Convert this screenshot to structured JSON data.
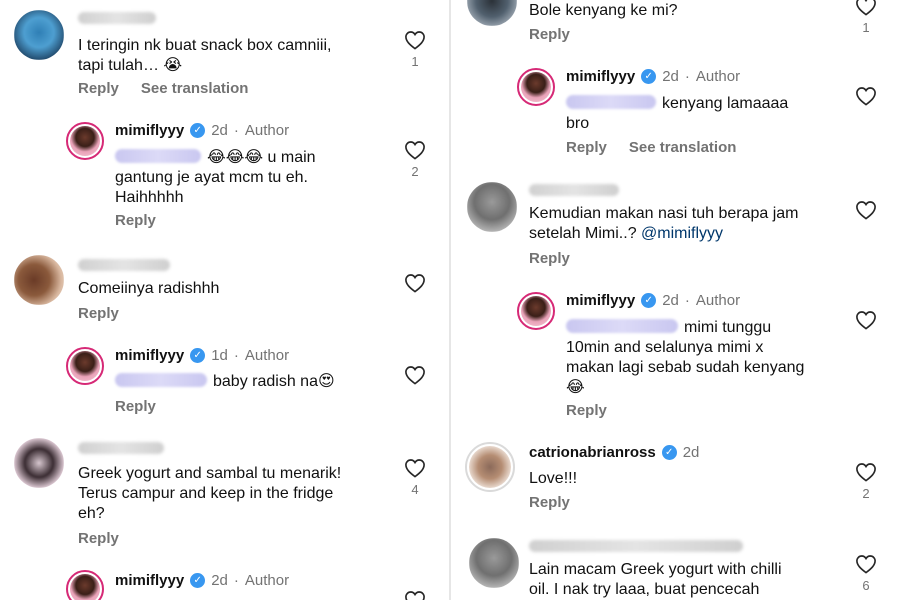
{
  "left": [
    {
      "type": "top",
      "avatar": "blue",
      "name_width": 78,
      "text_lines": [
        "I teringin nk buat snack box camniii,",
        "tapi  tulah… 😭"
      ],
      "reply": "Reply",
      "translate": "See translation",
      "likes": "1"
    },
    {
      "type": "reply",
      "username": "mimiflyyy",
      "time": "2d",
      "author": "Author",
      "mention_width": 86,
      "text_lines": [
        "😂😂😂 u main",
        "gantung je ayat mcm tu eh.",
        "Haihhhhh"
      ],
      "reply": "Reply",
      "likes": "2"
    },
    {
      "type": "top",
      "avatar": "brown",
      "name_width": 92,
      "text_lines": [
        "Comeiinya radishhh"
      ],
      "reply": "Reply",
      "likes": ""
    },
    {
      "type": "reply",
      "username": "mimiflyyy",
      "time": "1d",
      "author": "Author",
      "mention_width": 92,
      "text_lines": [
        "baby radish na😍"
      ],
      "reply": "Reply",
      "likes": ""
    },
    {
      "type": "top",
      "avatar": "pink",
      "name_width": 86,
      "text_lines": [
        "Greek yogurt and sambal tu menarik!",
        "Terus campur and keep in the fridge",
        "eh?"
      ],
      "reply": "Reply",
      "likes": "4"
    },
    {
      "type": "reply",
      "username": "mimiflyyy",
      "time": "2d",
      "author": "Author",
      "mention_width": 0,
      "text_lines": [],
      "reply": "",
      "likes": ""
    }
  ],
  "right": [
    {
      "type": "top",
      "avatar": "dark",
      "name_width": 0,
      "text_lines": [
        "Bole kenyang ke mi?"
      ],
      "reply": "Reply",
      "likes": "1"
    },
    {
      "type": "reply",
      "username": "mimiflyyy",
      "time": "2d",
      "author": "Author",
      "mention_width": 90,
      "text_lines": [
        "kenyang lamaaaa",
        "bro"
      ],
      "reply": "Reply",
      "translate": "See translation",
      "likes": ""
    },
    {
      "type": "top",
      "avatar": "grey",
      "name_width": 120,
      "text_lines": [
        "Kemudian makan nasi tuh berapa jam",
        "setelah Mimi..? "
      ],
      "mention_link": "@mimiflyyy",
      "reply": "Reply",
      "likes": ""
    },
    {
      "type": "reply",
      "username": "mimiflyyy",
      "time": "2d",
      "author": "Author",
      "mention_width": 112,
      "text_lines": [
        "mimi tunggu",
        "10min and selalunya mimi x",
        "makan lagi sebab sudah kenyang",
        "😂"
      ],
      "reply": "Reply",
      "likes": ""
    },
    {
      "type": "top",
      "avatar": "ring-grey",
      "username": "catrionabrianross",
      "time": "2d",
      "text_lines": [
        "Love!!!"
      ],
      "reply": "Reply",
      "likes": "2"
    },
    {
      "type": "top",
      "avatar": "grey",
      "name_width": 214,
      "text_lines": [
        "Lain macam Greek yogurt with chilli",
        "oil. I nak try laaa, buat pencecah"
      ],
      "reply": "",
      "likes": "6"
    }
  ],
  "ui": {
    "verified_glyph": "✓",
    "heart_icon": "heart-outline"
  }
}
